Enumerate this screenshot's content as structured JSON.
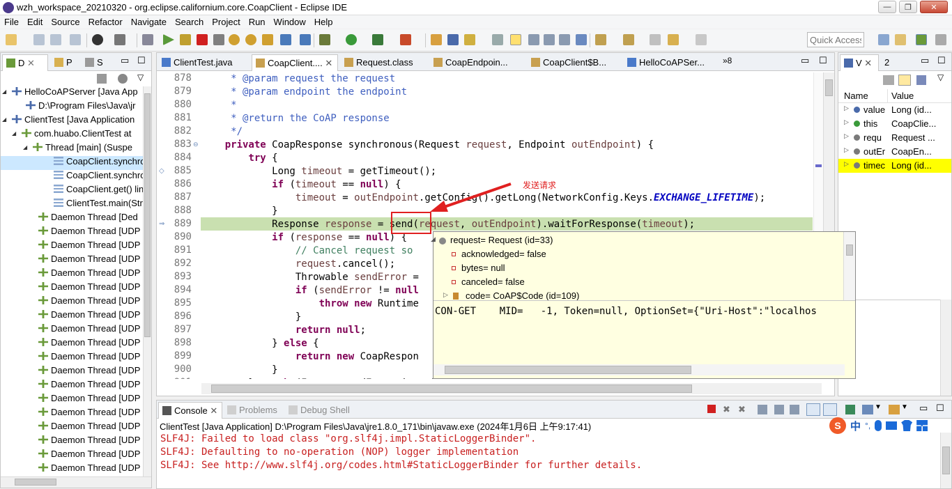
{
  "window": {
    "title": "wzh_workspace_20210320 - org.eclipse.californium.core.CoapClient - Eclipse IDE",
    "min": "—",
    "max": "❐",
    "close": "✕"
  },
  "menu": [
    "File",
    "Edit",
    "Source",
    "Refactor",
    "Navigate",
    "Search",
    "Project",
    "Run",
    "Window",
    "Help"
  ],
  "toolbar": {
    "quick_access": "Quick Access"
  },
  "debug_view": {
    "tabs": [
      "D",
      "P",
      "S"
    ],
    "rows": [
      "HelloCoAPServer [Java App",
      "D:\\Program Files\\Java\\jr",
      "ClientTest [Java Application",
      "com.huabo.ClientTest at",
      "Thread [main] (Suspe",
      "CoapClient.synchro",
      "CoapClient.synchro",
      "CoapClient.get() lin",
      "ClientTest.main(Stri",
      "Daemon Thread [Ded",
      "Daemon Thread [UDP",
      "Daemon Thread [UDP",
      "Daemon Thread [UDP",
      "Daemon Thread [UDP",
      "Daemon Thread [UDP",
      "Daemon Thread [UDP",
      "Daemon Thread [UDP",
      "Daemon Thread [UDP",
      "Daemon Thread [UDP",
      "Daemon Thread [UDP",
      "Daemon Thread [UDP",
      "Daemon Thread [UDP",
      "Daemon Thread [UDP",
      "Daemon Thread [UDP",
      "Daemon Thread [UDP",
      "Daemon Thread [UDP",
      "Daemon Thread [UDP",
      "Daemon Thread [UDP",
      "Daemon Thread [UDP"
    ]
  },
  "editor": {
    "tabs": [
      "ClientTest.java",
      "CoapClient....",
      "Request.class",
      "CoapEndpoin...",
      "CoapClient$B...",
      "HelloCoAPSer..."
    ],
    "overflow": "»8",
    "annotation": "发送请求",
    "line_numbers": [
      "878",
      "879",
      "880",
      "881",
      "882",
      "883",
      "884",
      "885",
      "886",
      "887",
      "888",
      "889",
      "890",
      "891",
      "892",
      "893",
      "894",
      "895",
      "896",
      "897",
      "898",
      "899",
      "900",
      "901"
    ]
  },
  "hover": {
    "rows": [
      "request= Request  (id=33)",
      "acknowledged= false",
      "bytes= null",
      "canceled= false",
      "code= CoAP$Code  (id=109)"
    ],
    "detail": "CON-GET    MID=   -1, Token=null, OptionSet={\"Uri-Host\":\"localhos"
  },
  "variables": {
    "tabs": [
      "V",
      "2"
    ],
    "headers": [
      "Name",
      "Value"
    ],
    "rows": [
      {
        "name": "value",
        "value": "Long  (id..."
      },
      {
        "name": "this",
        "value": "CoapClie..."
      },
      {
        "name": "requ",
        "value": "Request ..."
      },
      {
        "name": "outEr",
        "value": "CoapEn..."
      },
      {
        "name": "timec",
        "value": "Long  (id..."
      }
    ]
  },
  "console": {
    "tabs": [
      "Console",
      "Problems",
      "Debug Shell"
    ],
    "header": "ClientTest [Java Application] D:\\Program Files\\Java\\jre1.8.0_171\\bin\\javaw.exe (2024年1月6日 上午9:17:41)",
    "lines": [
      "SLF4J: Failed to load class \"org.slf4j.impl.StaticLoggerBinder\".",
      "SLF4J: Defaulting to no-operation (NOP) logger implementation",
      "SLF4J: See http://www.slf4j.org/codes.html#StaticLoggerBinder for further details."
    ]
  },
  "ime": {
    "label": "中"
  },
  "colors": {
    "current_line": "#c9e0b0",
    "console_error": "#c82020",
    "highlight": "#ffff00",
    "annotation": "#e02020"
  }
}
